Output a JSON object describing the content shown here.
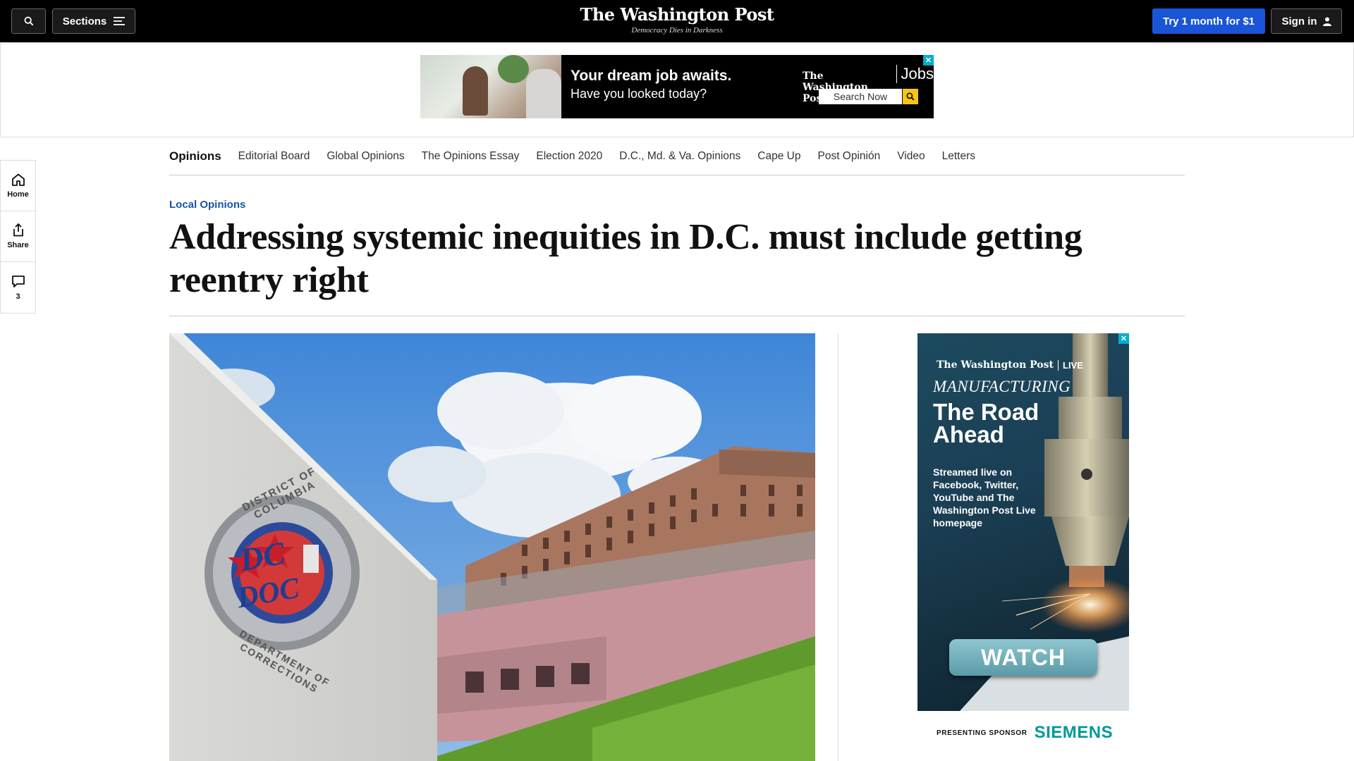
{
  "header": {
    "sections_label": "Sections",
    "logo": "The Washington Post",
    "tagline": "Democracy Dies in Darkness",
    "subscribe_label": "Try 1 month for $1",
    "signin_label": "Sign in",
    "brand_color": "#1955d6"
  },
  "top_ad": {
    "headline": "Your dream job awaits.",
    "subline": "Have you looked today?",
    "logo": "The Washington Post",
    "logo_suffix": "Jobs",
    "search_label": "Search Now",
    "close_label": "✕"
  },
  "nav": {
    "home": "Opinions",
    "items": [
      "Editorial Board",
      "Global Opinions",
      "The Opinions Essay",
      "Election 2020",
      "D.C., Md. & Va. Opinions",
      "Cape Up",
      "Post Opinión",
      "Video",
      "Letters"
    ]
  },
  "rail": {
    "home": "Home",
    "share": "Share",
    "comments": "3"
  },
  "article": {
    "kicker": "Local Opinions",
    "headline": "Addressing systemic inequities in D.C. must include getting reentry right",
    "image_sign_top": "DISTRICT OF COLUMBIA",
    "image_sign_bottom": "DEPARTMENT OF CORRECTIONS",
    "image_sign_mark_1": "DC",
    "image_sign_mark_2": "DOC"
  },
  "side_ad": {
    "logo": "The Washington Post",
    "logo_suffix": "LIVE",
    "eyebrow": "MANUFACTURING",
    "title": "The Road Ahead",
    "description": "Streamed live on Facebook, Twitter, YouTube and The Washington Post Live homepage",
    "cta": "WATCH",
    "close_label": "✕",
    "sponsor_label": "PRESENTING SPONSOR",
    "sponsor": "SIEMENS"
  }
}
